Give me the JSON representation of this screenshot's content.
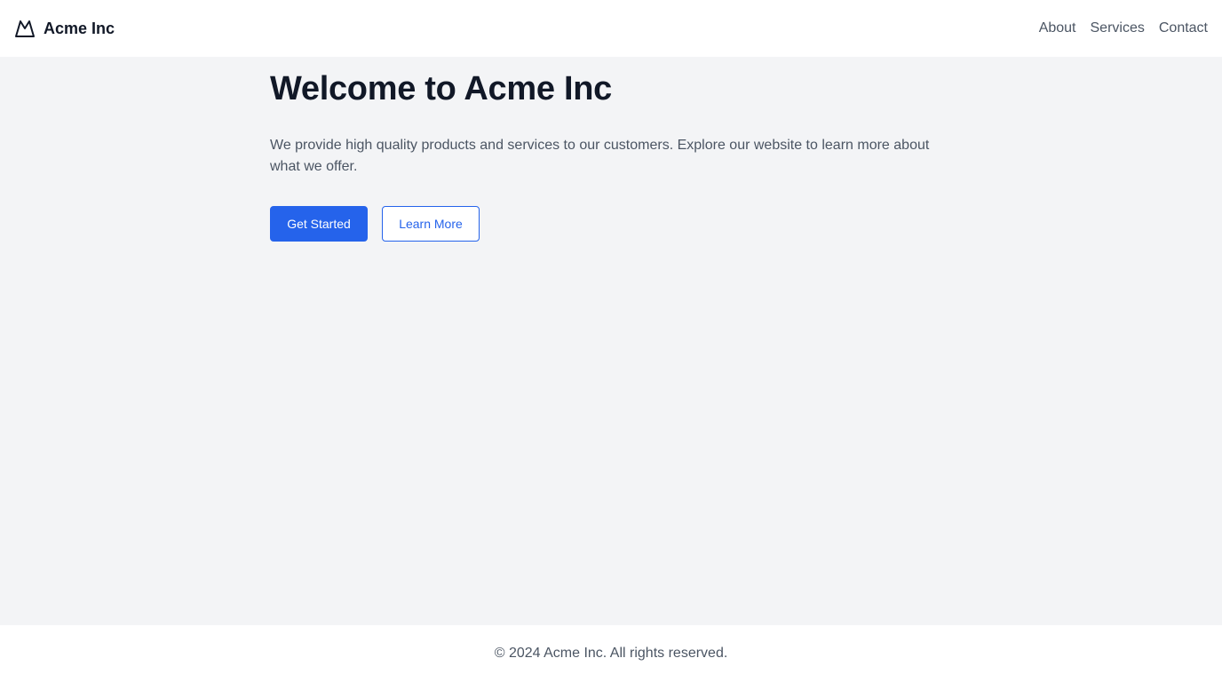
{
  "header": {
    "brand_name": "Acme Inc",
    "logo_icon": "mountain-icon",
    "nav": [
      {
        "label": "About"
      },
      {
        "label": "Services"
      },
      {
        "label": "Contact"
      }
    ]
  },
  "hero": {
    "title": "Welcome to Acme Inc",
    "description": "We provide high quality products and services to our customers. Explore our website to learn more about what we offer.",
    "primary_button": "Get Started",
    "secondary_button": "Learn More"
  },
  "footer": {
    "copyright": "© 2024 Acme Inc. All rights reserved."
  },
  "colors": {
    "accent": "#2563eb",
    "page_background": "#f3f4f6",
    "surface": "#ffffff",
    "heading_text": "#111827",
    "body_text": "#4b5563"
  }
}
